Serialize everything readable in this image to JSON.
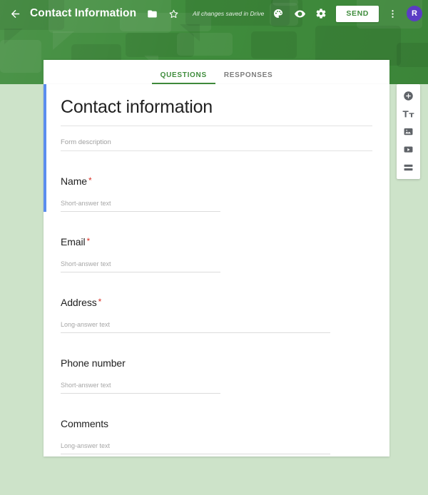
{
  "topbar": {
    "back_icon": "arrow-back-icon",
    "title": "Contact Information",
    "folder_icon": "folder-move-icon",
    "star_icon": "star-outline-icon",
    "save_status": "All changes saved in Drive",
    "palette_icon": "color-palette-icon",
    "preview_icon": "eye-preview-icon",
    "settings_icon": "gear-settings-icon",
    "send_label": "SEND",
    "more_icon": "more-vert-icon",
    "avatar_initial": "R"
  },
  "tabs": [
    {
      "label": "QUESTIONS",
      "active": true
    },
    {
      "label": "RESPONSES",
      "active": false
    }
  ],
  "form": {
    "title": "Contact information",
    "description_placeholder": "Form description",
    "questions": [
      {
        "label": "Name",
        "required": true,
        "required_mark": "*",
        "answer_placeholder": "Short-answer text",
        "answer_type": "short"
      },
      {
        "label": "Email",
        "required": true,
        "required_mark": "*",
        "answer_placeholder": "Short-answer text",
        "answer_type": "short"
      },
      {
        "label": "Address",
        "required": true,
        "required_mark": "*",
        "answer_placeholder": "Long-answer text",
        "answer_type": "long"
      },
      {
        "label": "Phone number",
        "required": false,
        "required_mark": "",
        "answer_placeholder": "Short-answer text",
        "answer_type": "short"
      },
      {
        "label": "Comments",
        "required": false,
        "required_mark": "",
        "answer_placeholder": "Long-answer text",
        "answer_type": "long"
      }
    ]
  },
  "side_toolbar": [
    {
      "icon": "add-question-icon"
    },
    {
      "icon": "add-title-icon"
    },
    {
      "icon": "add-image-icon"
    },
    {
      "icon": "add-video-icon"
    },
    {
      "icon": "add-section-icon"
    }
  ],
  "colors": {
    "theme_green": "#3f8c3c",
    "page_background": "#cde3c9",
    "selected_accent": "#5b8dee",
    "required_red": "#d93025",
    "avatar_purple": "#5b3cc4"
  }
}
